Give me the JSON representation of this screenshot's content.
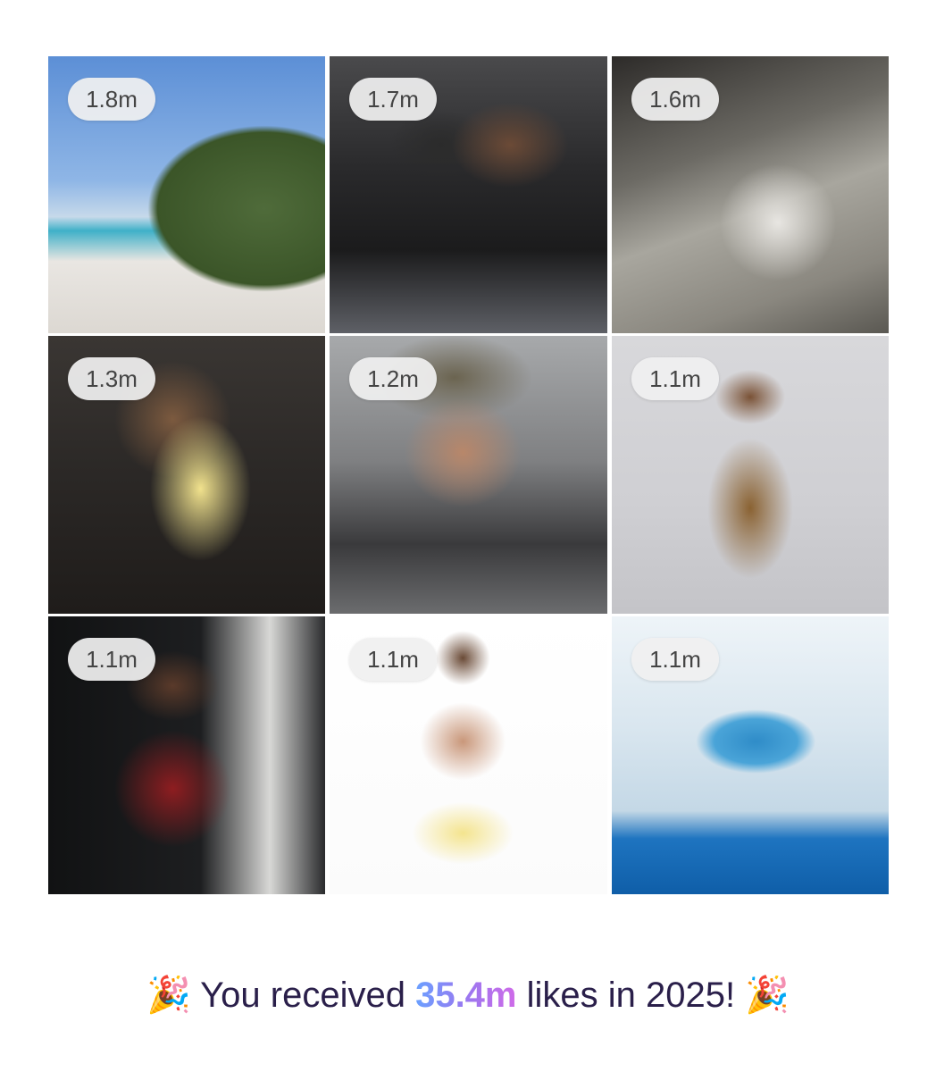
{
  "posts": [
    {
      "likes": "1.8m"
    },
    {
      "likes": "1.7m"
    },
    {
      "likes": "1.6m"
    },
    {
      "likes": "1.3m"
    },
    {
      "likes": "1.2m"
    },
    {
      "likes": "1.1m"
    },
    {
      "likes": "1.1m"
    },
    {
      "likes": "1.1m"
    },
    {
      "likes": "1.1m"
    }
  ],
  "summary": {
    "emoji": "🎉",
    "prefix": "You received",
    "total": "35.4m",
    "suffix": "likes in 2025!"
  },
  "colors": {
    "badge_bg": "#f0f0f0",
    "badge_text": "#444444",
    "summary_text": "#2a1f4a",
    "accent_gradient": [
      "#6aa0ff",
      "#9a78f0",
      "#d06ae8"
    ]
  }
}
